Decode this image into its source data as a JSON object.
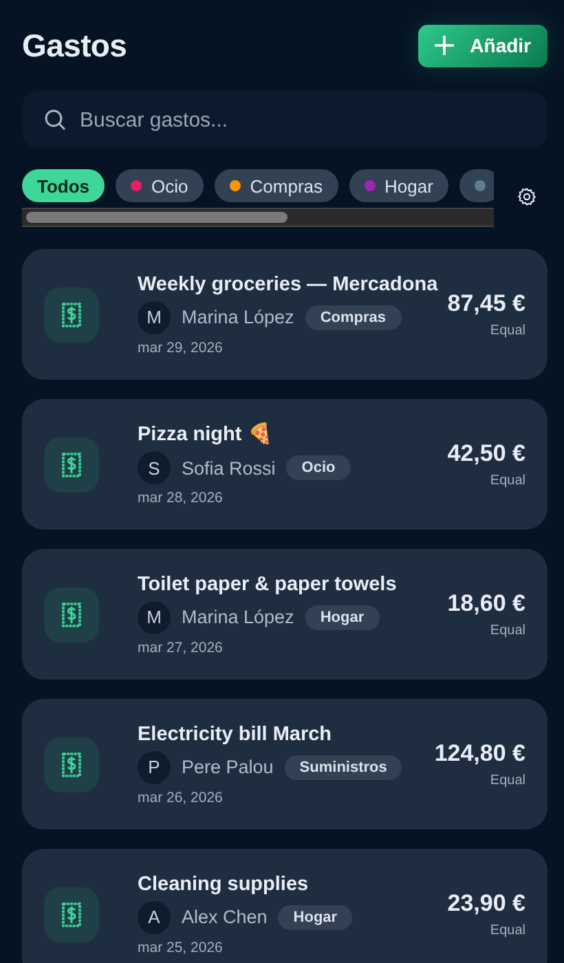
{
  "header": {
    "title": "Gastos",
    "add_button": "Añadir"
  },
  "search": {
    "placeholder": "Buscar gastos..."
  },
  "filters": [
    {
      "label": "Todos",
      "selected": true
    },
    {
      "label": "Ocio",
      "selected": false,
      "color": "#e91e63"
    },
    {
      "label": "Compras",
      "selected": false,
      "color": "#ff9800"
    },
    {
      "label": "Hogar",
      "selected": false,
      "color": "#9c27b0"
    },
    {
      "selected": false,
      "color": "#607d8b"
    }
  ],
  "expenses": [
    {
      "title": "Weekly groceries — Mercadona",
      "initial": "M",
      "payer": "Marina López",
      "category": "Compras",
      "date": "mar 29, 2026",
      "amount": "87,45 €",
      "split": "Equal"
    },
    {
      "title": "Pizza night 🍕",
      "initial": "S",
      "payer": "Sofia Rossi",
      "category": "Ocio",
      "date": "mar 28, 2026",
      "amount": "42,50 €",
      "split": "Equal"
    },
    {
      "title": "Toilet paper & paper towels",
      "initial": "M",
      "payer": "Marina López",
      "category": "Hogar",
      "date": "mar 27, 2026",
      "amount": "18,60 €",
      "split": "Equal"
    },
    {
      "title": "Electricity bill March",
      "initial": "P",
      "payer": "Pere Palou",
      "category": "Suministros",
      "date": "mar 26, 2026",
      "amount": "124,80 €",
      "split": "Equal"
    },
    {
      "title": "Cleaning supplies",
      "initial": "A",
      "payer": "Alex Chen",
      "category": "Hogar",
      "date": "mar 25, 2026",
      "amount": "23,90 €",
      "split": "Equal"
    }
  ]
}
